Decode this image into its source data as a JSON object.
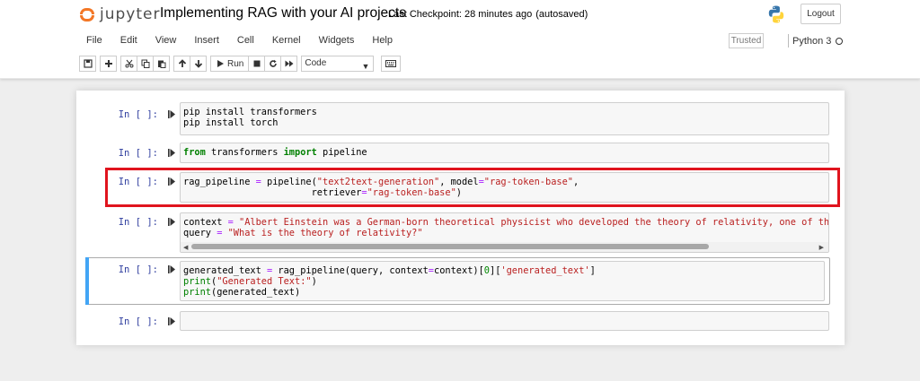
{
  "header": {
    "logo_text": "jupyter",
    "notebook_title": "Implementing RAG with your AI projects",
    "checkpoint": "Last Checkpoint: 28 minutes ago",
    "autosaved": "(autosaved)",
    "logout_label": "Logout",
    "python_logo_icon": "python-icon"
  },
  "menu": {
    "items": [
      "File",
      "Edit",
      "View",
      "Insert",
      "Cell",
      "Kernel",
      "Widgets",
      "Help"
    ],
    "trusted": "Trusted",
    "kernel": "Python 3"
  },
  "toolbar": {
    "run_label": "Run",
    "cell_type": "Code"
  },
  "cells": [
    {
      "prompt": "In [ ]:"
    },
    {
      "prompt": "In [ ]:"
    },
    {
      "prompt": "In [ ]:"
    },
    {
      "prompt": "In [ ]:"
    },
    {
      "prompt": "In [ ]:"
    },
    {
      "prompt": "In [ ]:"
    }
  ],
  "code": {
    "c1_l1": "pip install transformers",
    "c1_l2": "pip install torch",
    "c2_from": "from",
    "c2_mod": " transformers ",
    "c2_import": "import",
    "c2_name": " pipeline",
    "c3_l1_a": "rag_pipeline ",
    "c3_l1_eq": "=",
    "c3_l1_b": " pipeline(",
    "c3_l1_s1": "\"text2text-generation\"",
    "c3_l1_c": ", model",
    "c3_l1_eq2": "=",
    "c3_l1_s2": "\"rag-token-base\"",
    "c3_l1_d": ",",
    "c3_l2_a": "                       retriever",
    "c3_l2_eq": "=",
    "c3_l2_s": "\"rag-token-base\"",
    "c3_l2_b": ")",
    "c4_l1_a": "context ",
    "c4_l1_eq": "=",
    "c4_l1_s": " \"Albert Einstein was a German-born theoretical physicist who developed the theory of relativity, one of the two pil",
    "c4_l2_a": "query ",
    "c4_l2_eq": "=",
    "c4_l2_s": " \"What is the theory of relativity?\"",
    "c5_l1_a": "generated_text ",
    "c5_l1_eq": "=",
    "c5_l1_b": " rag_pipeline(query, context",
    "c5_l1_eq2": "=",
    "c5_l1_c": "context)[",
    "c5_l1_n": "0",
    "c5_l1_d": "][",
    "c5_l1_s": "'generated_text'",
    "c5_l1_e": "]",
    "c5_l2_a": "print",
    "c5_l2_b": "(",
    "c5_l2_s": "\"Generated Text:\"",
    "c5_l2_c": ")",
    "c5_l3_a": "print",
    "c5_l3_b": "(generated_text)"
  }
}
